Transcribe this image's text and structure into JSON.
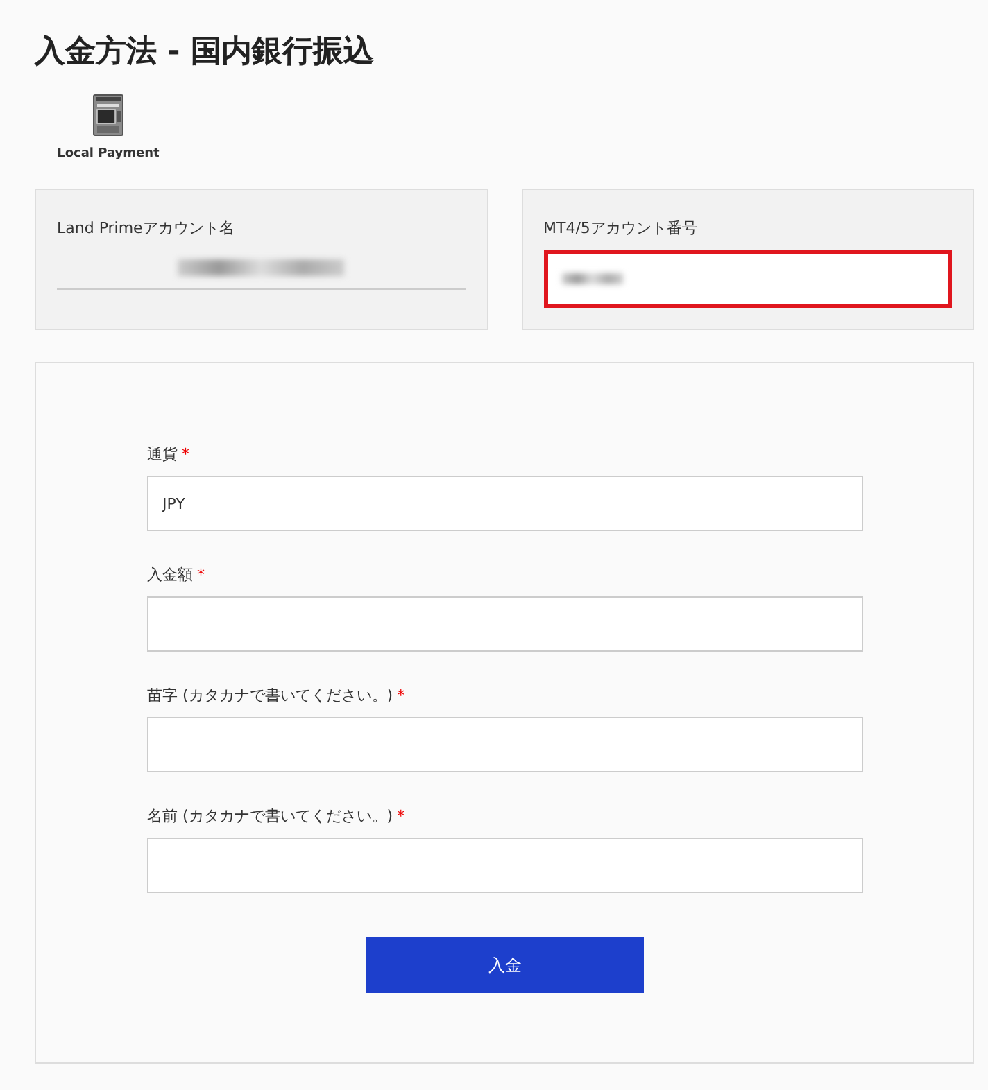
{
  "title": "入金方法 - 国内銀行振込",
  "payment_method": {
    "label": "Local Payment"
  },
  "accounts": [
    {
      "label": "Land Primeアカウント名",
      "kind": "underline",
      "highlighted": false
    },
    {
      "label": "MT4/5アカウント番号",
      "kind": "box",
      "highlighted": true
    }
  ],
  "form": {
    "fields": [
      {
        "label": "通貨",
        "required_mark": "*",
        "value": "JPY"
      },
      {
        "label": "入金額",
        "required_mark": "*"
      },
      {
        "label": "苗字 (カタカナで書いてください。)",
        "required_mark": "*"
      },
      {
        "label": "名前 (カタカナで書いてください。)",
        "required_mark": "*"
      }
    ],
    "submit": "入金"
  }
}
